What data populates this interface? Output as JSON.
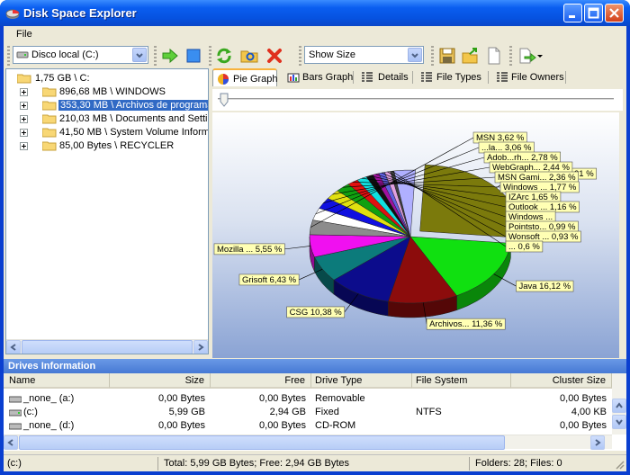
{
  "window": {
    "title": "Disk Space Explorer"
  },
  "menu": {
    "file": "File"
  },
  "toolbar": {
    "drive_select": "Disco local (C:)",
    "view_select": "Show Size"
  },
  "tree": {
    "root": "1,75 GB \\ C:",
    "items": [
      {
        "label": "896,68 MB \\ WINDOWS"
      },
      {
        "label": "353,30 MB \\ Archivos de programa"
      },
      {
        "label": "210,03 MB \\ Documents and Settings"
      },
      {
        "label": "41,50 MB \\ System Volume Information"
      },
      {
        "label": "85,00 Bytes \\ RECYCLER"
      }
    ]
  },
  "tabs": [
    {
      "label": "Pie Graph"
    },
    {
      "label": "Bars Graph"
    },
    {
      "label": "Details"
    },
    {
      "label": "File Types"
    },
    {
      "label": "File Owners"
    }
  ],
  "chart_data": {
    "type": "pie",
    "slices": [
      {
        "label": "LightZon... 26,31 %",
        "value": 26.31,
        "color": "#7b7a0c"
      },
      {
        "label": "Java 16,12 %",
        "value": 16.12,
        "color": "#10e010"
      },
      {
        "label": "Archivos... 11,36 %",
        "value": 11.36,
        "color": "#8c0c0c"
      },
      {
        "label": "CSG 10,38 %",
        "value": 10.38,
        "color": "#0c0c8c"
      },
      {
        "label": "Grisoft 6,43 %",
        "value": 6.43,
        "color": "#0c7b7b"
      },
      {
        "label": "Mozilla ... 5,55 %",
        "value": 5.55,
        "color": "#f010f0"
      },
      {
        "label": "MSN 3,62 %",
        "value": 3.62,
        "color": "#8c8c8c"
      },
      {
        "label": "...la... 3,06 %",
        "value": 3.06,
        "color": "#ffffff"
      },
      {
        "label": "Adob...rh... 2,78 %",
        "value": 2.78,
        "color": "#1010e0"
      },
      {
        "label": "WebGraph... 2,44 %",
        "value": 2.44,
        "color": "#e0e010"
      },
      {
        "label": "MSN Gami... 2,36 %",
        "value": 2.36,
        "color": "#10a010"
      },
      {
        "label": "Windows ... 1,77 %",
        "value": 1.77,
        "color": "#e01010"
      },
      {
        "label": "IZArc 1,65 %",
        "value": 1.65,
        "color": "#10e0e0"
      },
      {
        "label": "Outlook ... 1,16 %",
        "value": 1.16,
        "color": "#101010"
      },
      {
        "label": "Windows ...",
        "value": 1.0,
        "color": "#a010a0"
      },
      {
        "label": "Pointsto... 0,99 %",
        "value": 0.99,
        "color": "#6060e0"
      },
      {
        "label": "Wonsoft ... 0,93 %",
        "value": 0.93,
        "color": "#e0a0e0"
      },
      {
        "label": "... 0,6 %",
        "value": 0.6,
        "color": "#404040"
      },
      {
        "label": "",
        "value": 3.48,
        "color": "#b0b0ff"
      }
    ]
  },
  "drives": {
    "title": "Drives Information",
    "columns": [
      "Name",
      "Size",
      "Free",
      "Drive Type",
      "File System",
      "Cluster Size"
    ],
    "rows": [
      {
        "name": "_none_ (a:)",
        "size": "0,00 Bytes",
        "free": "0,00 Bytes",
        "type": "Removable",
        "fs": "",
        "cluster": "0,00 Bytes"
      },
      {
        "name": "(c:)",
        "size": "5,99 GB",
        "free": "2,94 GB",
        "type": "Fixed",
        "fs": "NTFS",
        "cluster": "4,00 KB"
      },
      {
        "name": "_none_ (d:)",
        "size": "0,00 Bytes",
        "free": "0,00 Bytes",
        "type": "CD-ROM",
        "fs": "",
        "cluster": "0,00 Bytes"
      }
    ]
  },
  "status": {
    "path": "(c:)",
    "totals": "Total: 5,99 GB Bytes; Free: 2,94 GB Bytes",
    "counts": "Folders: 28; Files: 0"
  }
}
